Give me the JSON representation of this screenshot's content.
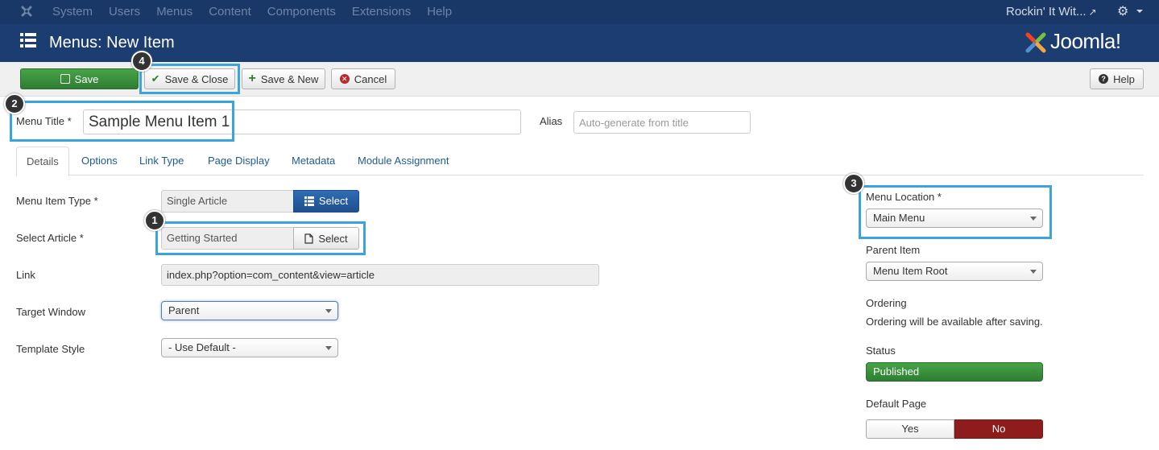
{
  "topnav": {
    "menu": [
      "System",
      "Users",
      "Menus",
      "Content",
      "Components",
      "Extensions",
      "Help"
    ],
    "site_name": "Rockin' It Wit..."
  },
  "header": {
    "title": "Menus: New Item",
    "logo_text": "Joomla!"
  },
  "toolbar": {
    "save": "Save",
    "save_close": "Save & Close",
    "save_new": "Save & New",
    "cancel": "Cancel",
    "help": "Help"
  },
  "form": {
    "menu_title_label": "Menu Title *",
    "menu_title_value": "Sample Menu Item 1",
    "alias_label": "Alias",
    "alias_placeholder": "Auto-generate from title"
  },
  "tabs": [
    "Details",
    "Options",
    "Link Type",
    "Page Display",
    "Metadata",
    "Module Assignment"
  ],
  "details": {
    "menu_item_type_label": "Menu Item Type *",
    "menu_item_type_value": "Single Article",
    "menu_item_type_button": "Select",
    "select_article_label": "Select Article *",
    "select_article_value": "Getting Started",
    "select_article_button": "Select",
    "link_label": "Link",
    "link_value": "index.php?option=com_content&view=article",
    "target_window_label": "Target Window",
    "target_window_value": "Parent",
    "template_style_label": "Template Style",
    "template_style_value": "- Use Default -"
  },
  "sidebar": {
    "menu_location_label": "Menu Location *",
    "menu_location_value": "Main Menu",
    "parent_item_label": "Parent Item",
    "parent_item_value": "Menu Item Root",
    "ordering_label": "Ordering",
    "ordering_text": "Ordering will be available after saving.",
    "status_label": "Status",
    "status_value": "Published",
    "default_page_label": "Default Page",
    "default_yes": "Yes",
    "default_no": "No"
  },
  "badges": [
    "1",
    "2",
    "3",
    "4"
  ],
  "colors": {
    "topnav_bg": "#1a3867",
    "header_bg": "#1c3d71",
    "highlight": "#39a5dc",
    "save_green": "#2f7d32",
    "select_blue": "#1f4f8c",
    "no_red": "#8e1c1c"
  },
  "icons": {
    "joomla": "joomla-icon",
    "list": "list-icon",
    "external": "external-link-icon",
    "gear": "gear-icon"
  }
}
